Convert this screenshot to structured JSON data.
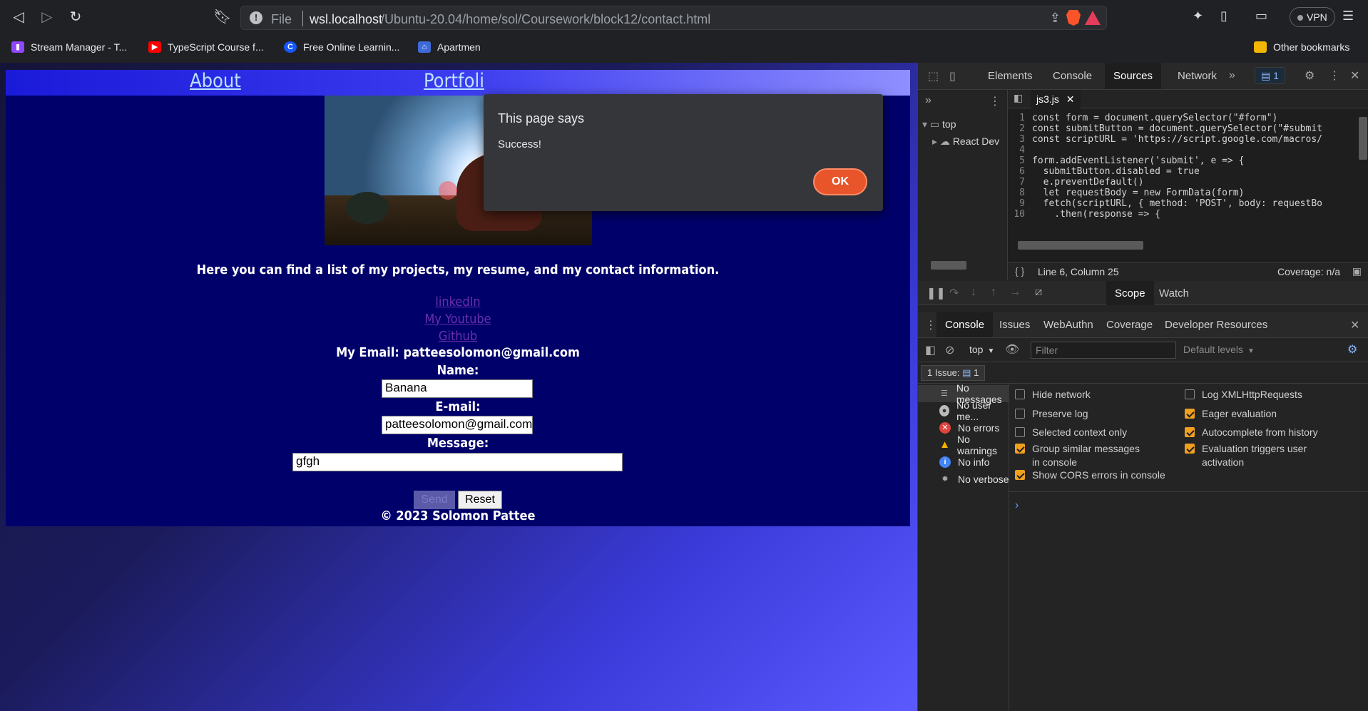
{
  "browser": {
    "url_scheme": "File",
    "url_host": "wsl.localhost",
    "url_path": "/Ubuntu-20.04/home/sol/Coursework/block12/contact.html",
    "vpn_label": "VPN",
    "bookmarks": [
      {
        "label": "Stream Manager - T...",
        "icon": "twitch-icon",
        "color": "#9146ff"
      },
      {
        "label": "TypeScript Course f...",
        "icon": "youtube-icon",
        "color": "#ff0000"
      },
      {
        "label": "Free Online Learnin...",
        "icon": "codecademy-icon",
        "color": "#1557ff"
      },
      {
        "label": "Apartmen",
        "icon": "apartments-icon",
        "color": "#3e6bd8"
      }
    ],
    "other_bookmarks": "Other bookmarks"
  },
  "site": {
    "nav": {
      "about": "About",
      "portfolio": "Portfoli"
    },
    "intro": "Here you can find a list of my projects, my resume, and my contact information.",
    "links": {
      "linkedin": "linkedIn",
      "youtube": "My Youtube",
      "github": "Github"
    },
    "email_line": "My Email: patteesolomon@gmail.com",
    "form": {
      "name_label": "Name:",
      "name_value": "Banana",
      "email_label": "E-mail:",
      "email_value": "patteesolomon@gmail.com",
      "message_label": "Message:",
      "message_value": "gfgh",
      "send_label": "Send",
      "reset_label": "Reset"
    },
    "footer": "© 2023 Solomon Pattee"
  },
  "alert": {
    "title": "This page says",
    "message": "Success!",
    "ok_label": "OK"
  },
  "devtools": {
    "tabs": [
      "Elements",
      "Console",
      "Sources",
      "Network"
    ],
    "active_tab": "Sources",
    "issues_count": "1",
    "tree": {
      "top": "top",
      "react": "React Dev"
    },
    "file_tab": "js3.js",
    "code_lines": [
      {
        "n": "1",
        "text": "const form = document.querySelector(\"#form\")"
      },
      {
        "n": "2",
        "text": "const submitButton = document.querySelector(\"#submit"
      },
      {
        "n": "3",
        "text": "const scriptURL = 'https://script.google.com/macros/"
      },
      {
        "n": "4",
        "text": ""
      },
      {
        "n": "5",
        "text": "form.addEventListener('submit', e => {"
      },
      {
        "n": "6",
        "text": "  submitButton.disabled = true"
      },
      {
        "n": "7",
        "text": "  e.preventDefault()"
      },
      {
        "n": "8",
        "text": "  let requestBody = new FormData(form)"
      },
      {
        "n": "9",
        "text": "  fetch(scriptURL, { method: 'POST', body: requestBo"
      },
      {
        "n": "10",
        "text": "    .then(response => {"
      }
    ],
    "cursor_position": "Line 6, Column 25",
    "coverage": "Coverage: n/a",
    "debug_tabs": {
      "scope": "Scope",
      "watch": "Watch"
    },
    "drawer_tabs": [
      "Console",
      "Issues",
      "WebAuthn",
      "Coverage",
      "Developer Resources"
    ],
    "console_context": "top",
    "filter_placeholder": "Filter",
    "levels": "Default levels",
    "issues_line": "1 Issue:",
    "issues_line_count": "1",
    "sidebar": [
      {
        "label": "No messages",
        "icon": "list-icon"
      },
      {
        "label": "No user me...",
        "icon": "user-icon"
      },
      {
        "label": "No errors",
        "icon": "error-icon"
      },
      {
        "label": "No warnings",
        "icon": "warning-icon"
      },
      {
        "label": "No info",
        "icon": "info-icon"
      },
      {
        "label": "No verbose",
        "icon": "bug-icon"
      }
    ],
    "options_left": [
      {
        "label": "Hide network",
        "checked": false
      },
      {
        "label": "Preserve log",
        "checked": false
      },
      {
        "label": "Selected context only",
        "checked": false
      },
      {
        "label": "Group similar messages in console",
        "checked": true
      },
      {
        "label": "Show CORS errors in console",
        "checked": true
      }
    ],
    "options_right": [
      {
        "label": "Log XMLHttpRequests",
        "checked": false
      },
      {
        "label": "Eager evaluation",
        "checked": true
      },
      {
        "label": "Autocomplete from history",
        "checked": true
      },
      {
        "label": "Evaluation triggers user activation",
        "checked": true
      }
    ]
  }
}
